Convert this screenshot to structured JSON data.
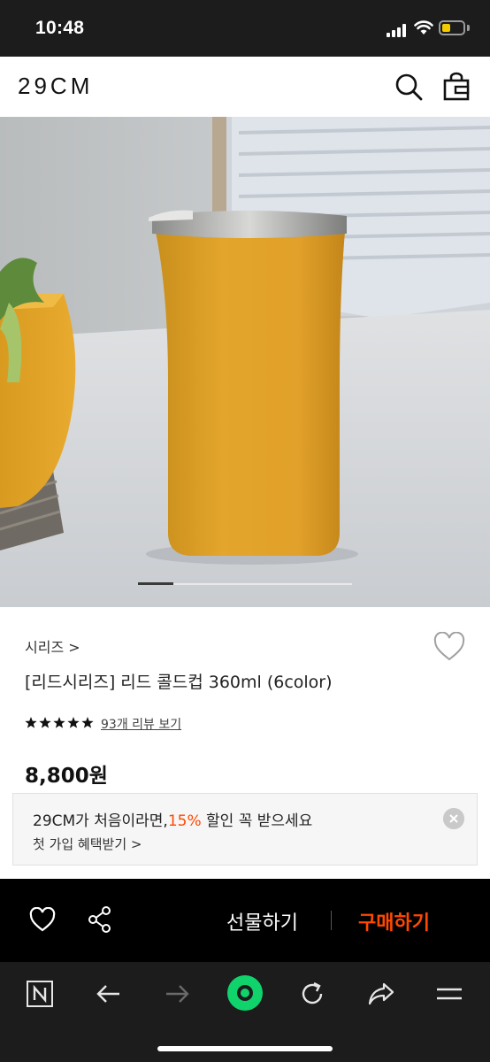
{
  "status_bar": {
    "time": "10:48"
  },
  "header": {
    "logo": "29CM"
  },
  "breadcrumb": "시리즈 >",
  "product": {
    "title": "[리드시리즈] 리드 콜드컵 360ml (6color)",
    "rating_stars": 5,
    "review_link": "93개 리뷰 보기",
    "price": "8,800원"
  },
  "promo": {
    "main_prefix": "29CM가 처음이라면,",
    "main_highlight": "15%",
    "main_suffix": " 할인 꼭 받으세요",
    "sub": "첫 가입 혜택받기 >",
    "highlight_color": "#ff4800"
  },
  "action_bar": {
    "gift_label": "선물하기",
    "buy_label": "구매하기",
    "buy_color": "#ff4800"
  },
  "image_pager": {
    "current": 1,
    "total": 6
  },
  "icons": {
    "header": [
      "search-icon",
      "shopping-bag-icon"
    ],
    "browser": [
      "naver-n-icon",
      "back-arrow-icon",
      "forward-arrow-icon",
      "green-home-icon",
      "reload-icon",
      "share-arrow-icon",
      "menu-icon"
    ]
  }
}
